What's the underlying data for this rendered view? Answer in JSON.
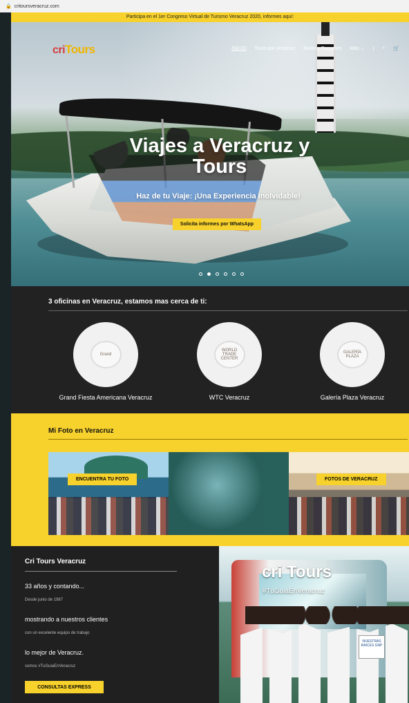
{
  "browser": {
    "url": "critoursveracruz.com"
  },
  "announcement": "Participa en el 1er Congreso Virtual de Turismo Veracruz 2020, informes aquí:",
  "header": {
    "logo": {
      "left": "cri",
      "right": "Tours"
    },
    "nav": [
      "INICIO",
      "Tours por Veracruz",
      "Rutas y Paquetes",
      "Más",
      "|"
    ],
    "icons": [
      "search-icon",
      "cart-icon"
    ]
  },
  "hero": {
    "title": "Viajes a Veracruz y Tours",
    "subtitle": "Haz de tu Viaje: ¡Una Experiencia Inolvidable!",
    "cta": "Solicita informes por WhatsApp",
    "slides": 6,
    "active_slide": 2
  },
  "offices": {
    "title": "3 oficinas en Veracruz, estamos mas cerca de ti:",
    "items": [
      {
        "logo_text": "Grand",
        "label": "Grand Fiesta Americana Veracruz"
      },
      {
        "logo_text": "WORLD TRADE CENTER",
        "label": "WTC Veracruz"
      },
      {
        "logo_text": "GALERÍA PLAZA",
        "label": "Galería Plaza Veracruz"
      }
    ]
  },
  "photo_section": {
    "title": "Mi Foto en Veracruz",
    "buttons": [
      "ENCUENTRA TU FOTO",
      "FOTOS DE VERACRUZ"
    ]
  },
  "about": {
    "title": "Cri Tours Veracruz",
    "items": [
      {
        "big": "33 años y contando...",
        "small": "Desde junio de 1987"
      },
      {
        "big": "mostrando a nuestros clientes",
        "small": "con un excelente equipo de trabajo"
      },
      {
        "big": "lo mejor de Veracruz.",
        "small": "somos #TuGuiaEnVeracruz"
      }
    ],
    "cta": "CONSULTAS EXPRESS",
    "bus_logo": "cri Tours",
    "hashtag": "#TuGuiaEnVeracruz",
    "sign_text": "NUESTRAS RAICES GNP"
  },
  "colors": {
    "accent": "#f7d12c",
    "dark": "#1d1d1d",
    "logo_red": "#d43e3e"
  }
}
